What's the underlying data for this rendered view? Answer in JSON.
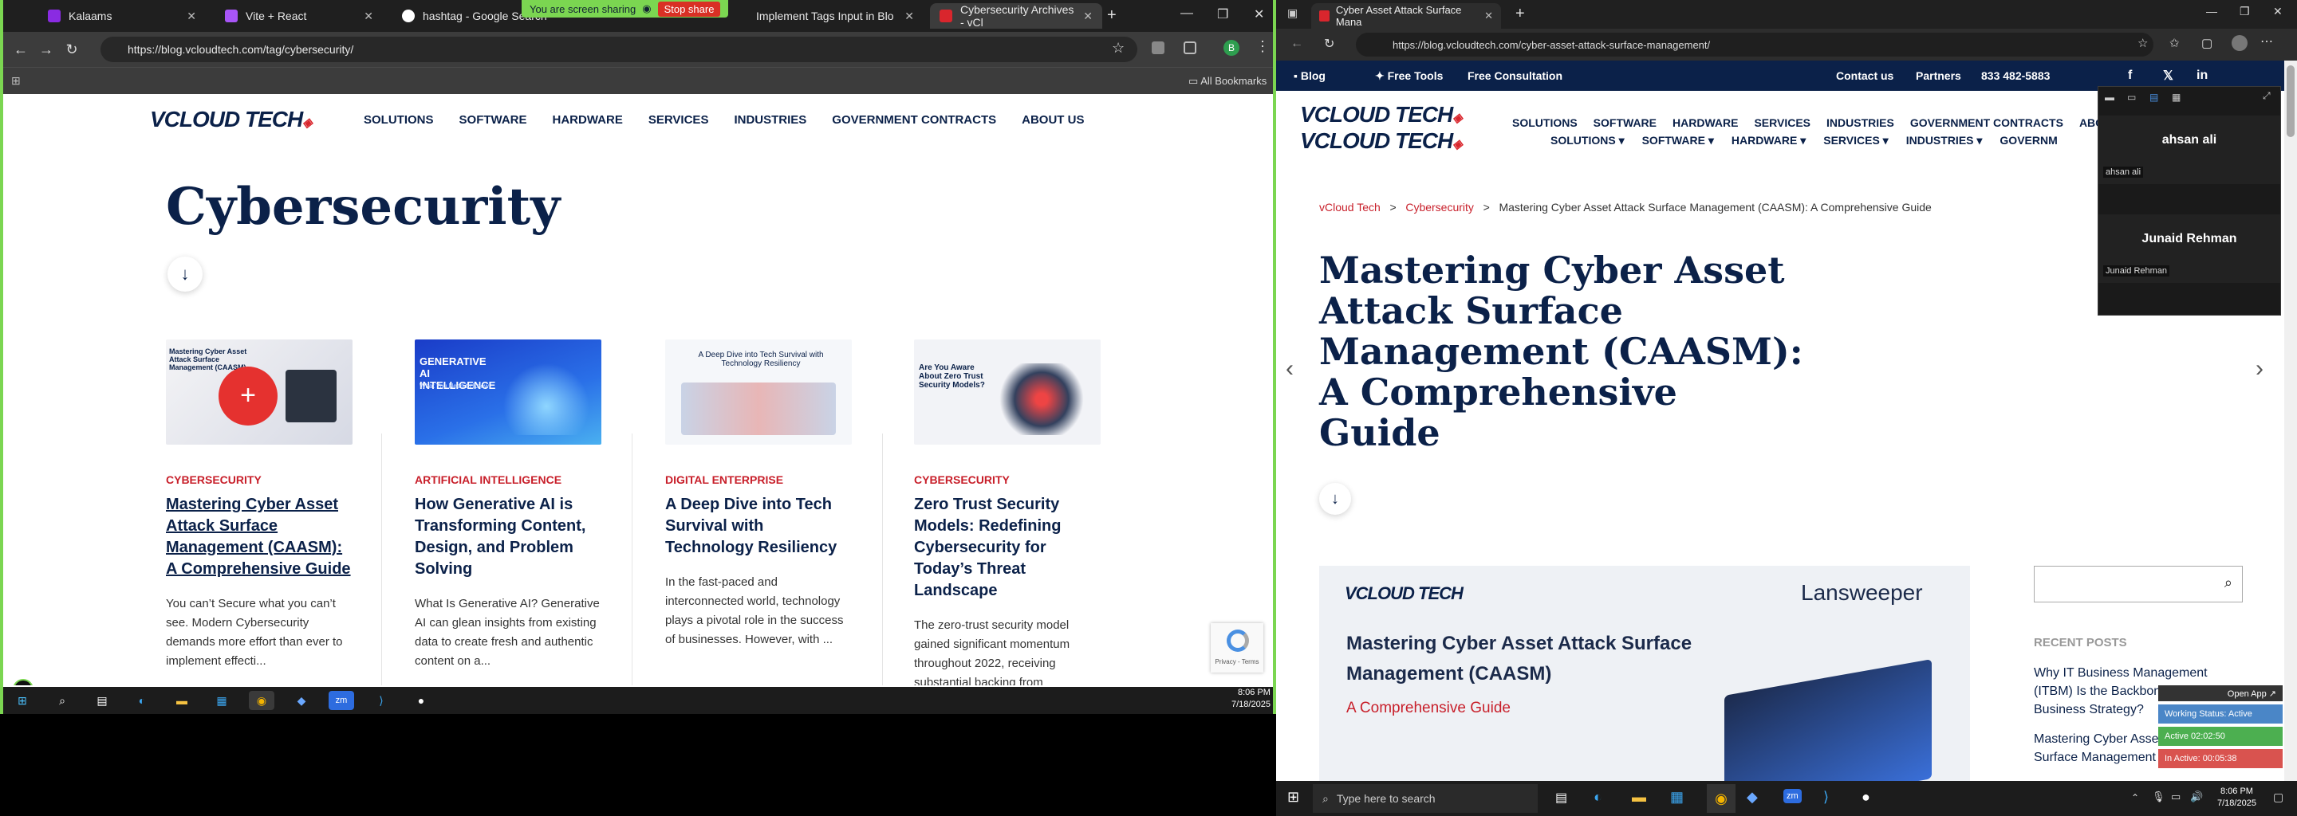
{
  "left_browser": {
    "tabs": [
      {
        "label": "Kalaams"
      },
      {
        "label": "Vite + React"
      },
      {
        "label": "hashtag - Google Search"
      },
      {
        "label": "Implement Tags Input in Blo"
      },
      {
        "label": "Cybersecurity Archives - vCl"
      }
    ],
    "share_bar": {
      "label": "You are screen sharing",
      "stop_label": "Stop share"
    },
    "url": "https://blog.vcloudtech.com/tag/cybersecurity/",
    "bookmarks_label": "All Bookmarks"
  },
  "left_site": {
    "logo_main": "VCLOUD TECH",
    "nav": [
      "SOLUTIONS",
      "SOFTWARE",
      "HARDWARE",
      "SERVICES",
      "INDUSTRIES",
      "GOVERNMENT CONTRACTS",
      "ABOUT US"
    ],
    "page_title": "Cybersecurity",
    "down_arrow": "↓",
    "cards": [
      {
        "category": "CYBERSECURITY",
        "title": "Mastering Cyber Asset Attack Surface Management (CAASM): A Comprehensive Guide",
        "excerpt": "You can’t Secure what you can’t see. Modern Cybersecurity demands more effort than ever to implement effecti...",
        "img_caption": "Mastering Cyber Asset Attack Surface Management (CAASM)"
      },
      {
        "category": "ARTIFICIAL INTELLIGENCE",
        "title": "How Generative AI is Transforming Content, Design, and Problem Solving",
        "excerpt": "What Is Generative AI? Generative AI can glean insights from existing data to create fresh and authentic content on a...",
        "img_caption": "GENERATIVE AI INTELLIGENCE",
        "img_sub": "What You Need to Know"
      },
      {
        "category": "DIGITAL ENTERPRISE",
        "title": "A Deep Dive into Tech Survival with Technology Resiliency",
        "excerpt": "In the fast-paced and interconnected world, technology plays a pivotal role in the success of businesses. However, with ...",
        "img_caption": "A Deep Dive into Tech Survival with Technology Resiliency"
      },
      {
        "category": "CYBERSECURITY",
        "title": "Zero Trust Security Models: Redefining Cybersecurity for Today’s Threat Landscape",
        "excerpt": "The zero-trust security model gained significant momentum throughout 2022, receiving substantial backing from",
        "img_caption": "Are You Aware About Zero Trust Security Models?"
      }
    ],
    "recaptcha": "Privacy - Terms"
  },
  "left_taskbar": {
    "time": "8:06 PM",
    "date": "7/18/2025"
  },
  "right_browser": {
    "tab_label": "Cyber Asset Attack Surface Mana",
    "url": "https://blog.vcloudtech.com/cyber-asset-attack-surface-management/"
  },
  "right_site": {
    "top_links": {
      "blog": "Blog",
      "free_tools": "Free Tools",
      "free_consultation": "Free Consultation",
      "contact": "Contact us",
      "partners": "Partners",
      "phone": "833 482-5883"
    },
    "logo_main": "VCLOUD TECH",
    "nav_row1": [
      "SOLUTIONS",
      "SOFTWARE",
      "HARDWARE",
      "SERVICES",
      "INDUSTRIES",
      "GOVERNMENT CONTRACTS",
      "ABOUT US"
    ],
    "nav_row2": [
      "SOLUTIONS",
      "SOFTWARE",
      "HARDWARE",
      "SERVICES",
      "INDUSTRIES",
      "GOVERNM"
    ],
    "breadcrumb": {
      "home": "vCloud Tech",
      "sep": ">",
      "category": "Cybersecurity",
      "current": "Mastering Cyber Asset Attack Surface Management (CAASM): A Comprehensive Guide"
    },
    "title_lines": [
      "Mastering Cyber Asset",
      "Attack Surface",
      "Management (CAASM):",
      "A Comprehensive",
      "Guide"
    ],
    "down_arrow": "↓",
    "banner": {
      "logo": "VCLOUD TECH",
      "partner": "Lansweeper",
      "heading_1": "Mastering Cyber Asset Attack Surface",
      "heading_2": "Management (CAASM)",
      "sub": "A Comprehensive Guide"
    },
    "recent_posts_label": "RECENT POSTS",
    "recent_posts": [
      "Why IT Business Management (ITBM) Is the Backbone of Modern Business Strategy?",
      "Mastering Cyber Asset Attack Surface Management (CAASM):"
    ]
  },
  "zoom_panel": {
    "participants": [
      {
        "name_big": "ahsan ali",
        "name_small": "ahsan ali"
      },
      {
        "name_big": "Junaid Rehman",
        "name_small": "Junaid Rehman"
      }
    ]
  },
  "work_widget": {
    "open_app": "Open App ↗",
    "status": "Working Status: Active",
    "active": "Active 02:02:50",
    "inactive": "In Active: 00:05:38"
  },
  "right_taskbar": {
    "search_placeholder": "Type here to search",
    "time": "8:06 PM",
    "date": "7/18/2025"
  },
  "colors": {
    "brand_navy": "#0b2149",
    "brand_red": "#c81f2a",
    "share_green": "#7bd651"
  }
}
